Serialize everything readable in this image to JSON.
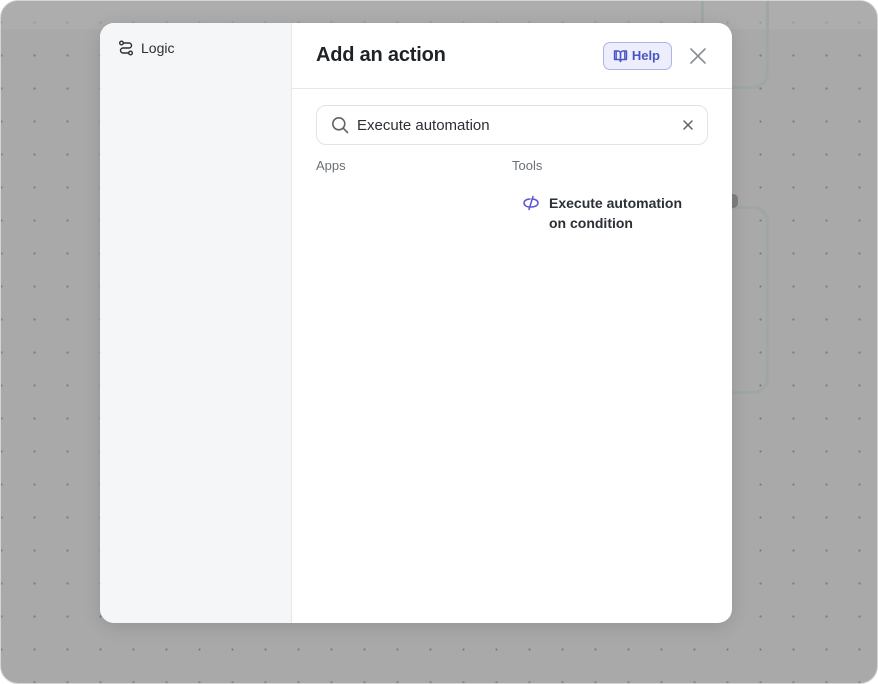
{
  "sidebar": {
    "items": [
      {
        "label": "Logic",
        "icon": "route-icon"
      }
    ]
  },
  "header": {
    "title": "Add an action",
    "help_label": "Help",
    "help_icon": "book-icon",
    "close_icon": "close-icon"
  },
  "search": {
    "value": "Execute automation",
    "icon": "search-icon",
    "clear_icon": "clear-icon"
  },
  "columns": {
    "apps": "Apps",
    "tools": "Tools"
  },
  "results": {
    "tools": [
      {
        "label": "Execute automation on condition",
        "icon": "conditional-icon"
      }
    ]
  },
  "colors": {
    "accent": "#4a55c4",
    "sidebar_bg": "#f5f6f8",
    "overlay": "#a9a9a9"
  }
}
